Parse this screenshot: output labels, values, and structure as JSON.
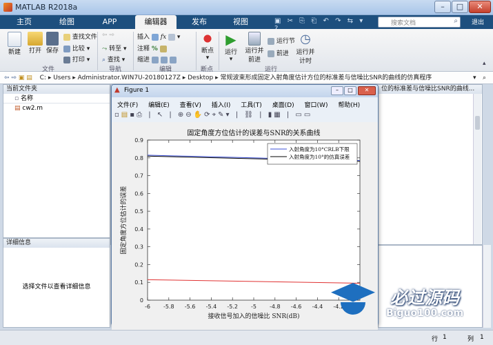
{
  "app": {
    "title": "MATLAB R2018a",
    "search_placeholder": "搜索文档",
    "user": "退出"
  },
  "tabs": [
    "主页",
    "绘图",
    "APP",
    "编辑器",
    "发布",
    "视图"
  ],
  "ribbon": {
    "file": {
      "new": "新建",
      "open": "打开",
      "save": "保存",
      "find_file": "查找文件",
      "compare": "比较",
      "print": "打印",
      "group": "文件"
    },
    "nav": {
      "goto": "转至",
      "find": "查找",
      "group": "导航"
    },
    "edit": {
      "insert": "插入",
      "comment": "注释",
      "indent": "缩进",
      "group": "编辑"
    },
    "breakpoints": {
      "label": "断点",
      "group": "断点"
    },
    "run": {
      "run": "运行",
      "run_advance": "运行并\n前进",
      "run_section": "运行节",
      "advance": "前进",
      "run_time": "运行并\n计时",
      "group": "运行"
    }
  },
  "path": {
    "segments": [
      "C:",
      "Users",
      "Administrator.WIN7U-20180127Z",
      "Desktop",
      "常规波束形成固定入射角度估计方位的标准差与信噪比SNR的曲线的仿真程序"
    ],
    "editor_title": "位的标准差与信噪比SNR的曲线..."
  },
  "current_folder": {
    "title": "当前文件夹",
    "col_name": "名称",
    "files": [
      "cw2.m"
    ]
  },
  "details": {
    "title": "详细信息",
    "message": "选择文件以查看详细信息"
  },
  "status": {
    "row_label": "行",
    "row": "1",
    "col_label": "列",
    "col": "1"
  },
  "watermark": {
    "brand": "必过源码",
    "url": "Biguo100.com"
  },
  "figure": {
    "title": "Figure 1",
    "menu": [
      "文件(F)",
      "编辑(E)",
      "查看(V)",
      "插入(I)",
      "工具(T)",
      "桌面(D)",
      "窗口(W)",
      "帮助(H)"
    ]
  },
  "chart_data": {
    "type": "line",
    "title": "固定角度方位估计的误差与SNR的关系曲线",
    "xlabel": "接收信号加入的信噪比 SNR(dB)",
    "ylabel": "固定角度方位估计的误差",
    "xlim": [
      -6,
      -4.0
    ],
    "ylim": [
      0,
      0.9
    ],
    "xticks": [
      "-6",
      "-5.8",
      "-5.6",
      "-5.4",
      "-5.2",
      "-5",
      "-4.8",
      "-4.6",
      "-4.4",
      "-4.2"
    ],
    "yticks": [
      "0",
      "0.1",
      "0.2",
      "0.3",
      "0.4",
      "0.5",
      "0.6",
      "0.7",
      "0.8",
      "0.9"
    ],
    "legend_position": "top-right",
    "series": [
      {
        "name": "入射角度为10°CRLB下限",
        "color": "#3b4fd6",
        "x": [
          -6,
          -4.0
        ],
        "y": [
          0.815,
          0.785
        ]
      },
      {
        "name": "入射角度为10°的仿真误差",
        "color": "#000000",
        "x": [
          -6,
          -4.0
        ],
        "y": [
          0.81,
          0.78
        ]
      },
      {
        "color": "#e03030",
        "x": [
          -6,
          -4.0
        ],
        "y": [
          0.115,
          0.095
        ]
      }
    ]
  }
}
